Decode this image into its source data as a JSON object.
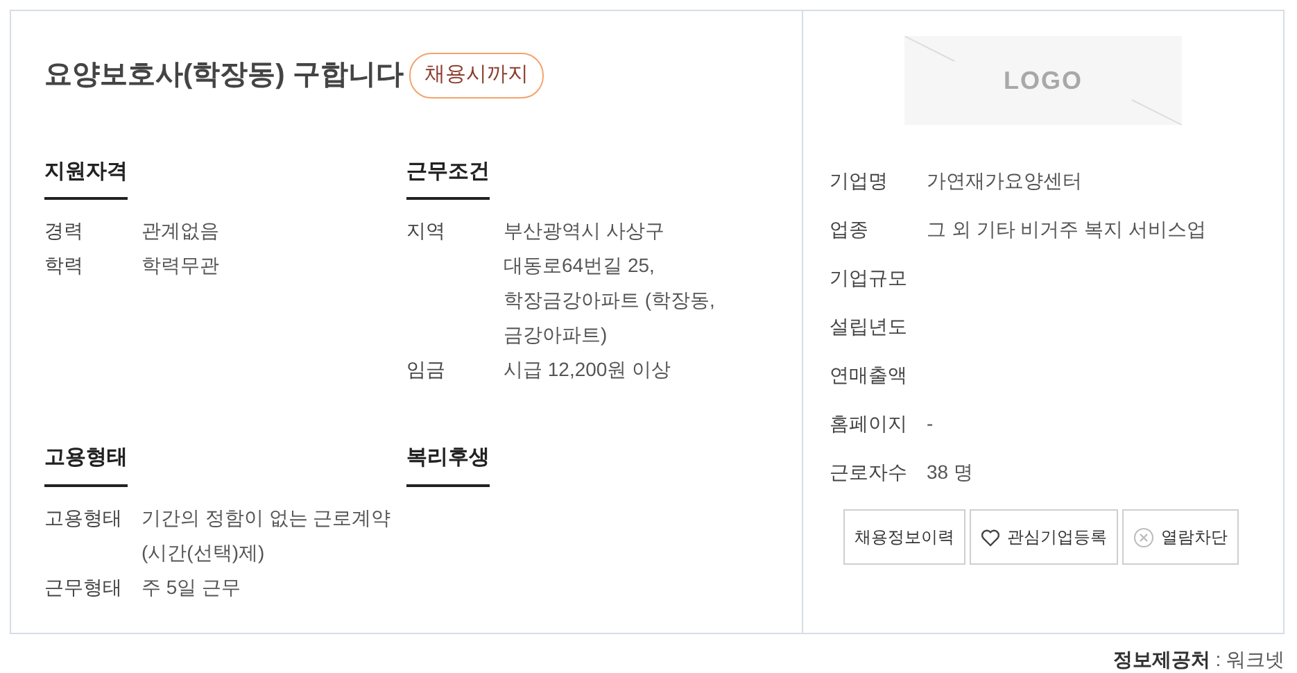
{
  "title": "요양보호사(학장동) 구합니다",
  "badge": "채용시까지",
  "sections": [
    {
      "heading": "지원자격",
      "rows": [
        {
          "label": "경력",
          "value": "관계없음"
        },
        {
          "label": "학력",
          "value": "학력무관"
        }
      ]
    },
    {
      "heading": "근무조건",
      "rows": [
        {
          "label": "지역",
          "value": "부산광역시 사상구 대동로64번길 25, 학장금강아파트 (학장동, 금강아파트)"
        },
        {
          "label": "임금",
          "value": "시급 12,200원 이상"
        }
      ]
    },
    {
      "heading": "고용형태",
      "rows": [
        {
          "label": "고용형태",
          "value": "기간의 정함이 없는 근로계약(시간(선택)제)"
        },
        {
          "label": "근무형태",
          "value": "주 5일 근무"
        }
      ]
    },
    {
      "heading": "복리후생"
    }
  ],
  "logo": {
    "text": "LOGO"
  },
  "company": [
    {
      "label": "기업명",
      "value": "가연재가요양센터"
    },
    {
      "label": "업종",
      "value": "그 외 기타 비거주 복지 서비스업"
    },
    {
      "label": "기업규모"
    },
    {
      "label": "설립년도"
    },
    {
      "label": "연매출액"
    },
    {
      "label": "홈페이지",
      "value": "-"
    },
    {
      "label": "근로자수",
      "value": "38 명"
    }
  ],
  "buttons": [
    {
      "label": "채용정보이력",
      "kind": "plain"
    },
    {
      "label": "관심기업등록",
      "kind": "heart"
    },
    {
      "label": "열람차단",
      "kind": "block"
    }
  ],
  "source": {
    "label": "정보제공처",
    "separator": ":",
    "value": "워크넷"
  }
}
